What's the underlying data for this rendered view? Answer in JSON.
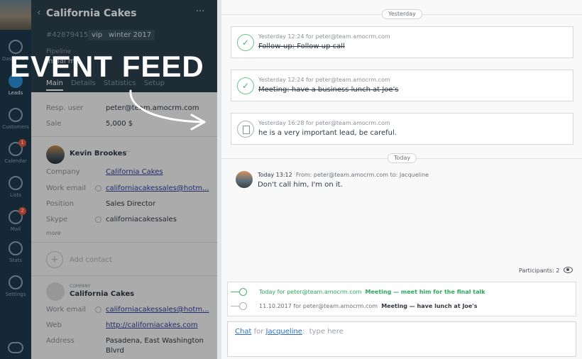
{
  "nav": {
    "items": [
      {
        "label": "Dashboard",
        "icon": "dashboard-icon"
      },
      {
        "label": "Leads",
        "icon": "leads-icon",
        "active": true
      },
      {
        "label": "Customers",
        "icon": "customers-icon"
      },
      {
        "label": "Calendar",
        "icon": "calendar-icon",
        "badge": "1"
      },
      {
        "label": "Lists",
        "icon": "lists-icon"
      },
      {
        "label": "Mail",
        "icon": "mail-icon",
        "badge": "2"
      },
      {
        "label": "Stats",
        "icon": "stats-icon"
      },
      {
        "label": "Settings",
        "icon": "settings-icon"
      }
    ]
  },
  "lead": {
    "title": "California Cakes",
    "id": "#42879415",
    "tags": [
      "vip",
      "winter 2017"
    ],
    "pipeline_label": "Pipeline",
    "stage": "Initial m...",
    "tabs": [
      "Main",
      "Details",
      "Statistics",
      "Setup"
    ],
    "resp_user_label": "Resp. user",
    "resp_user": "peter@team.amocrm.com",
    "sale_label": "Sale",
    "sale": "5,000 $"
  },
  "contact": {
    "name": "Kevin Brookes",
    "company_label": "Company",
    "company": "California Cakes",
    "work_email_label": "Work email",
    "work_email": "californiacakessales@hotm...",
    "position_label": "Position",
    "position": "Sales Director",
    "skype_label": "Skype",
    "skype": "californiacakessales",
    "more": "more",
    "add_contact": "Add contact"
  },
  "company": {
    "section_label": "COMPANY",
    "name": "California Cakes",
    "work_email_label": "Work email",
    "work_email": "californiacakessales@hotm...",
    "web_label": "Web",
    "web": "http://californiacakes.com",
    "address_label": "Address",
    "address_line1": "Pasadena, East Washington",
    "address_line2": "Blvrd"
  },
  "overlay": {
    "banner": "EVENT FEED"
  },
  "feed": {
    "yesterday_label": "Yesterday",
    "today_label": "Today",
    "notes": [
      {
        "meta": "Yesterday 12:24 for peter@team.amocrm.com",
        "text": "Follow-up: Follow up call",
        "type": "done"
      },
      {
        "meta": "Yesterday 12:24 for peter@team.amocrm.com",
        "text": "Meeting: have a business lunch at Joe's",
        "type": "done"
      },
      {
        "meta": "Yesterday 16:28 for peter@team.amocrm.com",
        "text": "he is a very important lead, be careful.",
        "type": "note"
      }
    ],
    "message": {
      "time": "Today 13:12",
      "from_label": "From:",
      "from": "peter@team.amocrm.com",
      "to_label": "to:",
      "to": "Jacqueline",
      "text": "Don't call him, I'm on it."
    },
    "participants": "Participants: 2",
    "tasks": [
      {
        "when": "Today for peter@team.amocrm.com",
        "title": "Meeting — meet him for the final talk",
        "status": "today"
      },
      {
        "when": "11.10.2017 for peter@team.amocrm.com",
        "title": "Meeting — have lunch at Joe's",
        "status": "later"
      }
    ],
    "composer": {
      "mode": "Chat",
      "for_label": "for",
      "recipient": "Jacqueline",
      "placeholder": "type here"
    }
  },
  "colors": {
    "nav_bg": "#1f3a4d",
    "accent_green": "#2eaa5d",
    "link_blue": "#2b6fbf"
  }
}
